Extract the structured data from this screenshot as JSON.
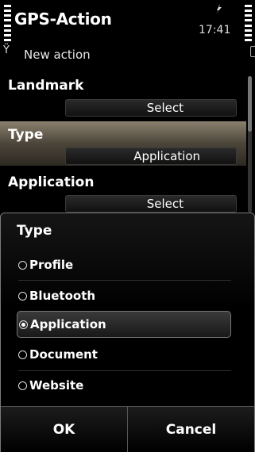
{
  "status": {
    "app_title": "GPS-Action",
    "clock": "17:41",
    "subtitle": "New action",
    "antenna_glyph": "Ÿ"
  },
  "form": {
    "landmark_label": "Landmark",
    "landmark_value": "Select",
    "type_label": "Type",
    "type_value": "Application",
    "application_label": "Application",
    "application_value": "Select"
  },
  "popup": {
    "title": "Type",
    "options": [
      {
        "label": "Profile",
        "selected": false
      },
      {
        "label": "Bluetooth",
        "selected": false
      },
      {
        "label": "Application",
        "selected": true
      },
      {
        "label": "Document",
        "selected": false
      },
      {
        "label": "Website",
        "selected": false
      }
    ],
    "ok_label": "OK",
    "cancel_label": "Cancel"
  },
  "colors": {
    "highlight_top": "#8a806f",
    "highlight_bottom": "#2d2922",
    "popup_border": "#7a7a7a"
  },
  "icons": [
    "signal-strength-icon",
    "gps-icon",
    "antenna-icon",
    "battery-level-icon",
    "radio-icon"
  ]
}
